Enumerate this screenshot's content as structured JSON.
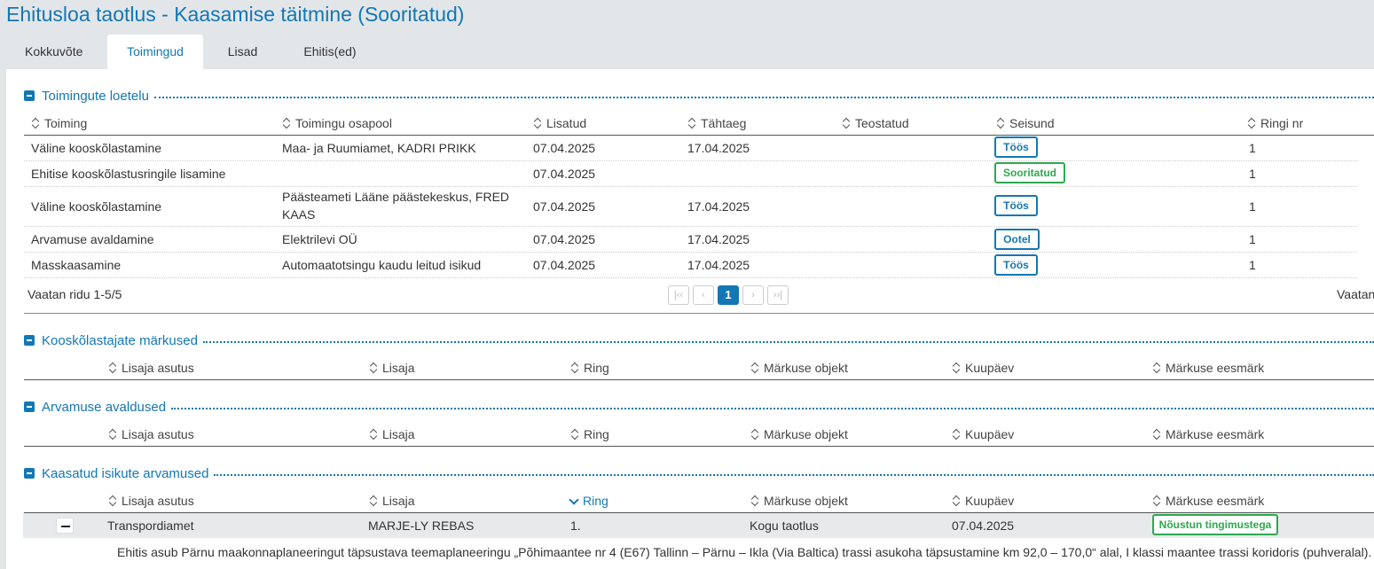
{
  "page": {
    "title": "Ehitusloa taotlus - Kaasamise täitmine (Sooritatud)"
  },
  "tabs": [
    {
      "label": "Kokkuvõte"
    },
    {
      "label": "Toimingud"
    },
    {
      "label": "Lisad"
    },
    {
      "label": "Ehitis(ed)"
    }
  ],
  "toimingud": {
    "title": "Toimingute loetelu",
    "columns": [
      "Toiming",
      "Toimingu osapool",
      "Lisatud",
      "Tähtaeg",
      "Teostatud",
      "Seisund",
      "Ringi nr"
    ],
    "rows": [
      {
        "toiming": "Väline kooskõlastamine",
        "osapool": "Maa- ja Ruumiamet, KADRI PRIKK",
        "lisatud": "07.04.2025",
        "tahtaeg": "17.04.2025",
        "teostatud": "",
        "seisund": "Töös",
        "ring": "1"
      },
      {
        "toiming": "Ehitise kooskõlastusringile lisamine",
        "osapool": "",
        "lisatud": "07.04.2025",
        "tahtaeg": "",
        "teostatud": "",
        "seisund": "Sooritatud",
        "ring": "1"
      },
      {
        "toiming": "Väline kooskõlastamine",
        "osapool": "Päästeameti Lääne päästekeskus, FRED KAAS",
        "lisatud": "07.04.2025",
        "tahtaeg": "17.04.2025",
        "teostatud": "",
        "seisund": "Töös",
        "ring": "1"
      },
      {
        "toiming": "Arvamuse avaldamine",
        "osapool": "Elektrilevi OÜ",
        "lisatud": "07.04.2025",
        "tahtaeg": "17.04.2025",
        "teostatud": "",
        "seisund": "Ootel",
        "ring": "1"
      },
      {
        "toiming": "Masskaasamine",
        "osapool": "Automaatotsingu kaudu leitud isikud",
        "lisatud": "07.04.2025",
        "tahtaeg": "17.04.2025",
        "teostatud": "",
        "seisund": "Töös",
        "ring": "1"
      }
    ],
    "footer_left": "Vaatan ridu 1-5/5",
    "footer_right": "Vaatan",
    "pager": {
      "first": "|‹‹",
      "prev": "‹",
      "current": "1",
      "next": "›",
      "last": "››|"
    }
  },
  "markused": {
    "title": "Kooskõlastajate märkused",
    "columns": [
      "Lisaja asutus",
      "Lisaja",
      "Ring",
      "Märkuse objekt",
      "Kuupäev",
      "Märkuse eesmärk"
    ]
  },
  "avaldused": {
    "title": "Arvamuse avaldused",
    "columns": [
      "Lisaja asutus",
      "Lisaja",
      "Ring",
      "Märkuse objekt",
      "Kuupäev",
      "Märkuse eesmärk"
    ]
  },
  "kaasatud": {
    "title": "Kaasatud isikute arvamused",
    "columns": [
      "Lisaja asutus",
      "Lisaja",
      "Ring",
      "Märkuse objekt",
      "Kuupäev",
      "Märkuse eesmärk"
    ],
    "row": {
      "asutus": "Transpordiamet",
      "lisaja": "MARJE-LY REBAS",
      "ring": "1.",
      "objekt": "Kogu taotlus",
      "kuupaev": "07.04.2025",
      "eesmark": "Nõustun tingimustega",
      "detail": "Ehitis asub Pärnu maakonnaplaneeringut täpsustava teemaplaneeringu „Põhimaantee nr 4 (E67) Tallinn – Pärnu – Ikla (Via Baltica) trassi asukoha täpsustamine km 92,0 – 170,0“ alal, I klassi maantee trassi koridoris (puhveralal)."
    }
  },
  "colors": {
    "accent": "#1377b4",
    "success": "#2fa84f"
  }
}
